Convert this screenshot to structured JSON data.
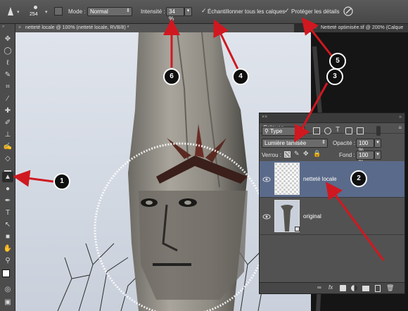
{
  "options_bar": {
    "brush_size": "254",
    "mode_label": "Mode :",
    "mode_value": "Normal",
    "intensity_label": "Intensité :",
    "intensity_value": "34 %",
    "sample_all_layers_label": "Échantillonner tous les calques",
    "protect_details_label": "Protéger les détails"
  },
  "tabs": [
    {
      "label": "netteté locale @ 100% (netteté locale, RVB/8) *"
    },
    {
      "label": "Netteté optimisée.tif @ 200% (Calque"
    }
  ],
  "layers_panel": {
    "title": "Calques",
    "filter_kind": "Type",
    "blend_mode": "Lumière tamisée",
    "opacity_label": "Opacité :",
    "opacity_value": "100 %",
    "lock_label": "Verrou :",
    "fill_label": "Fond :",
    "fill_value": "100 %",
    "layers": [
      {
        "name": "netteté locale"
      },
      {
        "name": "original"
      }
    ]
  },
  "callouts": [
    "1",
    "2",
    "3",
    "4",
    "5",
    "6"
  ],
  "colors": {
    "accent_arrow": "#d01820",
    "panel_bg": "#525252",
    "selected_layer": "#5a6a8a",
    "toolbar_bg": "#4c4c4c"
  }
}
